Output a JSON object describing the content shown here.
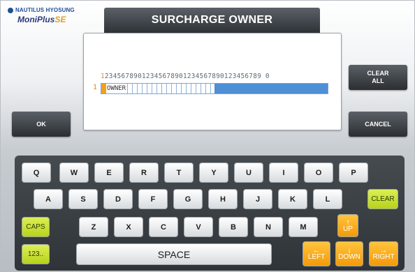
{
  "logo": {
    "brand": "NAUTILUS HYOSUNG",
    "product_main": "MoniPlus",
    "product_suffix": "SE"
  },
  "title": "SURCHARGE OWNER",
  "editor": {
    "ruler_first": "1",
    "ruler_rest": "23456789012345678901234567890123456789 0",
    "line_number": "1",
    "value": "OWNER"
  },
  "buttons": {
    "clear_all_1": "CLEAR",
    "clear_all_2": "ALL",
    "ok": "OK",
    "cancel": "CANCEL"
  },
  "keyboard": {
    "row1": [
      "Q",
      "W",
      "E",
      "R",
      "T",
      "Y",
      "U",
      "I",
      "O",
      "P"
    ],
    "row2": [
      "A",
      "S",
      "D",
      "F",
      "G",
      "H",
      "J",
      "K",
      "L"
    ],
    "row3": [
      "Z",
      "X",
      "C",
      "V",
      "B",
      "N",
      "M"
    ],
    "clear": "CLEAR",
    "caps": "CAPS",
    "num": "123..",
    "space": "SPACE",
    "up": "UP",
    "left": "LEFT",
    "down": "DOWN",
    "right": "RIGHT",
    "up_icon": "arrow-up-icon",
    "left_icon": "arrow-left-icon",
    "down_icon": "arrow-down-icon",
    "right_icon": "arrow-right-icon"
  },
  "colors": {
    "accent_orange": "#f29a0a",
    "clear_green": "#c6dd2a",
    "input_fill": "#4e8fd6"
  }
}
